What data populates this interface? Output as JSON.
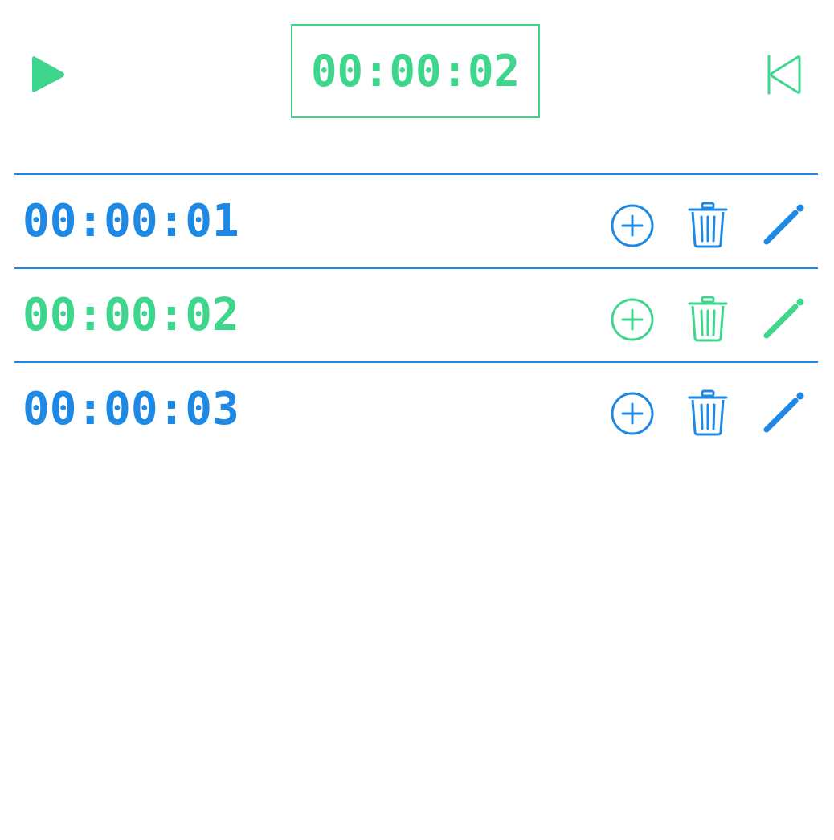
{
  "colors": {
    "active": "#3dd68c",
    "inactive": "#1e88e5"
  },
  "header": {
    "play_icon": "play-icon",
    "current_time": "00:00:02",
    "reset_icon": "skip-to-start-icon"
  },
  "intervals": [
    {
      "time": "00:00:01",
      "active": false
    },
    {
      "time": "00:00:02",
      "active": true
    },
    {
      "time": "00:00:03",
      "active": false
    }
  ],
  "row_icons": {
    "add": "add-circle-icon",
    "delete": "trash-icon",
    "edit": "pencil-icon"
  }
}
